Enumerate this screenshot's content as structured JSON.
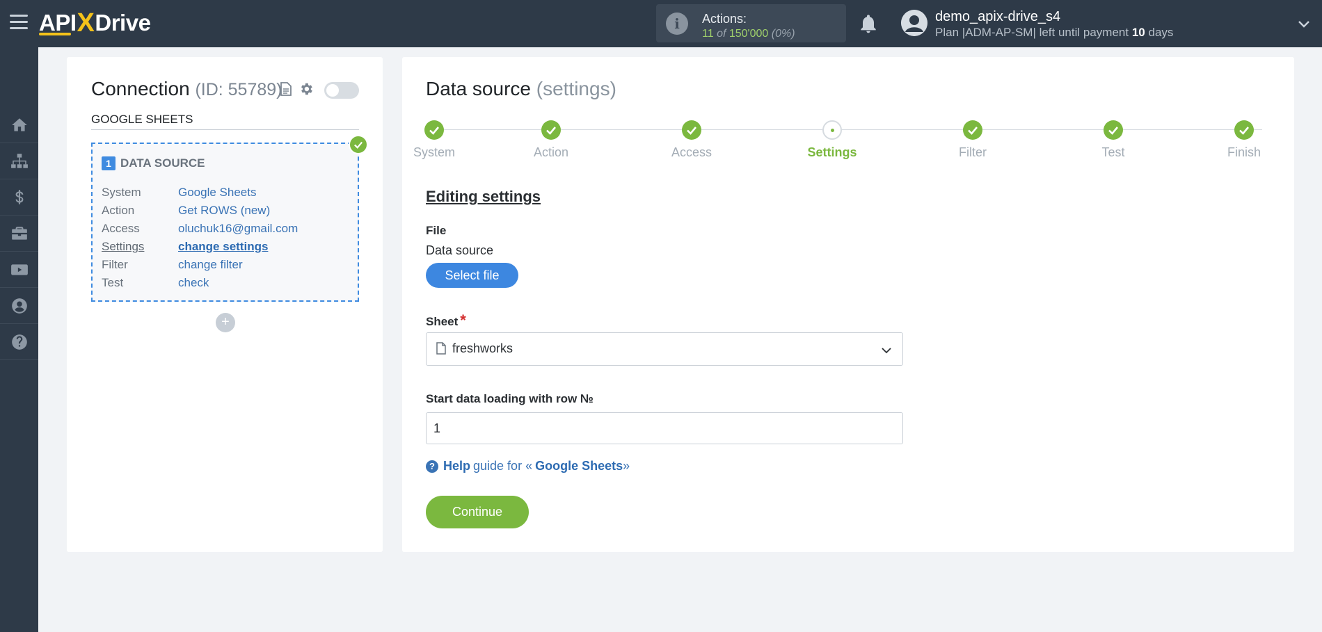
{
  "header": {
    "logo_prefix": "API",
    "logo_x": "X",
    "logo_suffix": "Drive",
    "actions_label": "Actions:",
    "actions_used": "11",
    "actions_of": "of",
    "actions_total": "150'000",
    "actions_pct": "(0%)",
    "username": "demo_apix-drive_s4",
    "plan_text": "Plan |ADM-AP-SM| left until payment",
    "plan_days": "10",
    "plan_unit": "days"
  },
  "sidebar": {
    "items": [
      {
        "icon": "home-icon"
      },
      {
        "icon": "sitemap-icon"
      },
      {
        "icon": "dollar-icon"
      },
      {
        "icon": "briefcase-icon"
      },
      {
        "icon": "video-icon"
      },
      {
        "icon": "user-icon"
      },
      {
        "icon": "help-icon"
      }
    ]
  },
  "connection": {
    "title": "Connection",
    "id_text": "(ID: 55789)",
    "system_name": "GOOGLE SHEETS",
    "data_source": {
      "number": "1",
      "title": "DATA SOURCE",
      "rows": [
        {
          "key": "System",
          "value": "Google Sheets"
        },
        {
          "key": "Action",
          "value": "Get ROWS (new)"
        },
        {
          "key": "Access",
          "value": "oluchuk16@gmail.com"
        },
        {
          "key": "Settings",
          "value": "change settings"
        },
        {
          "key": "Filter",
          "value": "change filter"
        },
        {
          "key": "Test",
          "value": "check"
        }
      ]
    },
    "add_label": "+"
  },
  "main": {
    "title": "Data source",
    "title_suffix": "(settings)",
    "steps": [
      {
        "label": "System"
      },
      {
        "label": "Action"
      },
      {
        "label": "Access"
      },
      {
        "label": "Settings"
      },
      {
        "label": "Filter"
      },
      {
        "label": "Test"
      },
      {
        "label": "Finish"
      }
    ],
    "editing_title": "Editing settings",
    "file_label": "File",
    "data_source_label": "Data source",
    "select_file_label": "Select file",
    "sheet_label": "Sheet",
    "sheet_required": "*",
    "sheet_value": "freshworks",
    "start_row_label": "Start data loading with row №",
    "start_row_value": "1",
    "help_prefix": "Help",
    "help_middle": "guide for «",
    "help_target": "Google Sheets",
    "help_suffix": "»",
    "continue_label": "Continue"
  },
  "colors": {
    "topbar": "#2e3a48",
    "accent_green": "#7bb83f",
    "accent_blue": "#3d87e0",
    "link_blue": "#3a73b5"
  }
}
